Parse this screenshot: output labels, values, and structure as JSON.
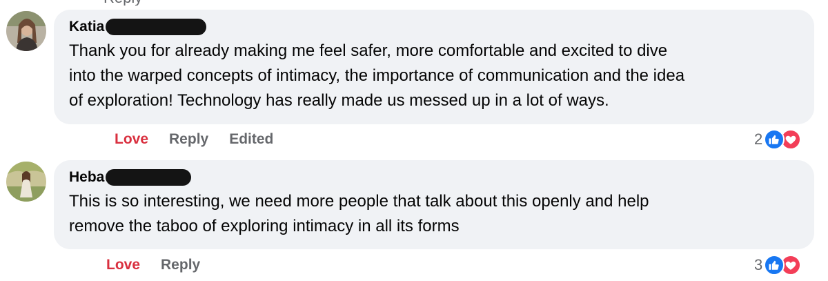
{
  "thread": {
    "top_partial_label": "Reply"
  },
  "comments": [
    {
      "author": "Katia",
      "text_lines": [
        "Thank you for already making me feel safer, more comfortable and excited to dive",
        "into the warped concepts of intimacy, the importance of communication and the idea",
        "of exploration! Technology has really made us messed up in a lot of ways."
      ],
      "actions": {
        "love": "Love",
        "reply": "Reply",
        "edited": "Edited"
      },
      "reaction_count": "2",
      "reaction_icons": [
        "like-icon",
        "heart-icon"
      ]
    },
    {
      "author": "Heba",
      "text_lines": [
        "This is so interesting, we need more people that talk about this openly and help",
        "remove the taboo of exploring intimacy in all its forms"
      ],
      "actions": {
        "love": "Love",
        "reply": "Reply"
      },
      "reaction_count": "3",
      "reaction_icons": [
        "like-icon",
        "heart-icon"
      ]
    }
  ],
  "colors": {
    "bubble": "#f0f2f5",
    "love_active": "#d9303f",
    "muted_text": "#65676b",
    "like_blue": "#1877f2",
    "heart_red": "#f33e58",
    "redaction": "#141414"
  }
}
